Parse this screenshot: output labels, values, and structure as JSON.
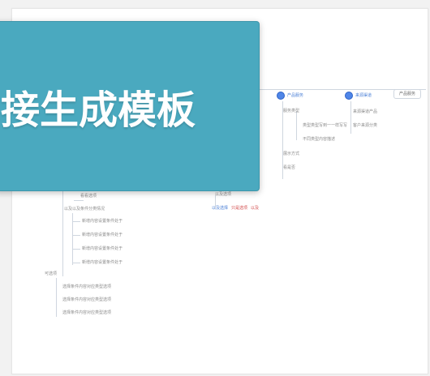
{
  "banner": {
    "title": "接生成模板"
  },
  "right_panel": {
    "col1_header": "产品服务",
    "col1_items": [
      "服务类型",
      "类型类型写到一一样写写",
      "不同类型内容描述",
      "展示方式",
      "看是否"
    ],
    "col2_header": "来源渠道",
    "col2_items": [
      "来源渠道产品",
      "客户来源分类"
    ],
    "action_button": "产品服务"
  },
  "left_tree": {
    "item_top": "看看选项",
    "group_label": "以及以及条件分类情况",
    "sub_items": [
      "新增内容设置条件处于",
      "新增内容设置条件处于",
      "新增内容设置条件处于",
      "新增内容设置条件处于"
    ],
    "section2_label": "可选项",
    "section2_items": [
      "选择条件内容对应类型选项",
      "选择条件内容对应类型选项",
      "选择条件内容对应类型选项"
    ]
  },
  "middle_tree": {
    "label_a": "以及选项",
    "label_b_parts": [
      "以及选择",
      "只是选项",
      "以及"
    ]
  },
  "colors": {
    "banner": "#4aa9bf",
    "node_dot": "#4f86e8",
    "link": "#4a7fd6",
    "alert": "#d24b4b"
  }
}
